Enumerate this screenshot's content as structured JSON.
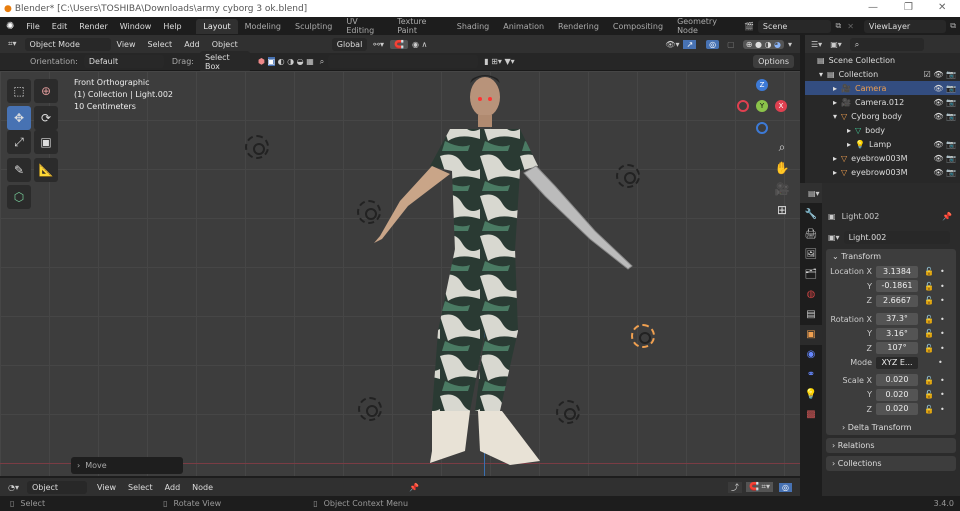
{
  "window": {
    "title": "Blender* [C:\\Users\\TOSHIBA\\Downloads\\army cyborg 3 ok.blend]",
    "minimize": "—",
    "maximize": "❐",
    "close": "✕"
  },
  "menu": [
    "File",
    "Edit",
    "Render",
    "Window",
    "Help"
  ],
  "workspaces": [
    "Layout",
    "Modeling",
    "Sculpting",
    "UV Editing",
    "Texture Paint",
    "Shading",
    "Animation",
    "Rendering",
    "Compositing",
    "Geometry Node"
  ],
  "scene": "Scene",
  "view_layer": "ViewLayer",
  "viewport_header": {
    "mode": "Object Mode",
    "menus": [
      "View",
      "Select",
      "Add",
      "Object"
    ],
    "transform_orientation": "Global"
  },
  "tool_settings": {
    "orientation_label": "Orientation:",
    "orientation": "Default",
    "drag_label": "Drag:",
    "drag": "Select Box",
    "options": "Options"
  },
  "viewport": {
    "view_name": "Front Orthographic",
    "collection_info": "(1) Collection | Light.002",
    "scale": "10 Centimeters",
    "last_op": "Move",
    "gizmo": {
      "x": "X",
      "y": "Y",
      "z": "Z"
    }
  },
  "outliner": {
    "root": "Scene Collection",
    "items": [
      {
        "name": "Collection",
        "depth": 0
      },
      {
        "name": "Camera",
        "depth": 1,
        "selected": true
      },
      {
        "name": "Camera.012",
        "depth": 1
      },
      {
        "name": "Cyborg body",
        "depth": 1
      },
      {
        "name": "body",
        "depth": 2
      },
      {
        "name": "Lamp",
        "depth": 2
      },
      {
        "name": "eyebrow003M",
        "depth": 1
      },
      {
        "name": "eyebrow003M",
        "depth": 1
      }
    ]
  },
  "properties": {
    "object_name": "Light.002",
    "data_name": "Light.002",
    "transform_label": "Transform",
    "location": {
      "label": "Location X",
      "x": "3.1384",
      "y": "-0.1861",
      "z": "2.6667"
    },
    "rotation": {
      "label": "Rotation X",
      "x": "37.3°",
      "y": "3.16°",
      "z": "107°"
    },
    "mode_label": "Mode",
    "mode": "XYZ E...",
    "scale": {
      "label": "Scale X",
      "x": "0.020",
      "y": "0.020",
      "z": "0.020"
    },
    "axis_y": "Y",
    "axis_z": "Z",
    "delta": "Delta Transform",
    "relations": "Relations",
    "collections": "Collections"
  },
  "node_editor": {
    "type": "Object",
    "menus": [
      "View",
      "Select",
      "Add",
      "Node"
    ]
  },
  "status": {
    "select": "Select",
    "rotate": "Rotate View",
    "context": "Object Context Menu",
    "version": "3.4.0"
  },
  "colors": {
    "accent": "#4772b3",
    "selected_text": "#f0a050"
  }
}
